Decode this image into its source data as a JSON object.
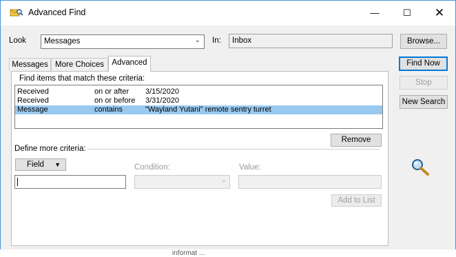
{
  "window": {
    "title": "Advanced Find",
    "icon": "advanced-find-app-icon",
    "controls": {
      "minimize": "—",
      "maximize": "☐",
      "close": "✕"
    }
  },
  "search": {
    "look_label": "Look",
    "look_value": "Messages",
    "in_label": "In:",
    "in_value": "Inbox",
    "browse_label": "Browse..."
  },
  "actions": {
    "find_now": "Find Now",
    "stop": "Stop",
    "new_search": "New Search",
    "magnifier_icon": "magnifier-icon"
  },
  "tabs": [
    {
      "label": "Messages",
      "active": false
    },
    {
      "label": "More Choices",
      "active": false
    },
    {
      "label": "Advanced",
      "active": true
    }
  ],
  "advanced": {
    "criteria_heading": "Find items that match these criteria:",
    "criteria": [
      {
        "field": "Received",
        "condition": "on or after",
        "value": "3/15/2020",
        "selected": false
      },
      {
        "field": "Received",
        "condition": "on or before",
        "value": "3/31/2020",
        "selected": false
      },
      {
        "field": "Message",
        "condition": "contains",
        "value": "\"Wayland Yutani\" remote sentry turret",
        "selected": true
      }
    ],
    "remove_label": "Remove",
    "define_more": "Define more criteria:",
    "field_button": "Field",
    "field_input_value": "",
    "condition_label": "Condition:",
    "value_label": "Value:",
    "add_to_list": "Add to List"
  },
  "background_residue": "informat ..."
}
